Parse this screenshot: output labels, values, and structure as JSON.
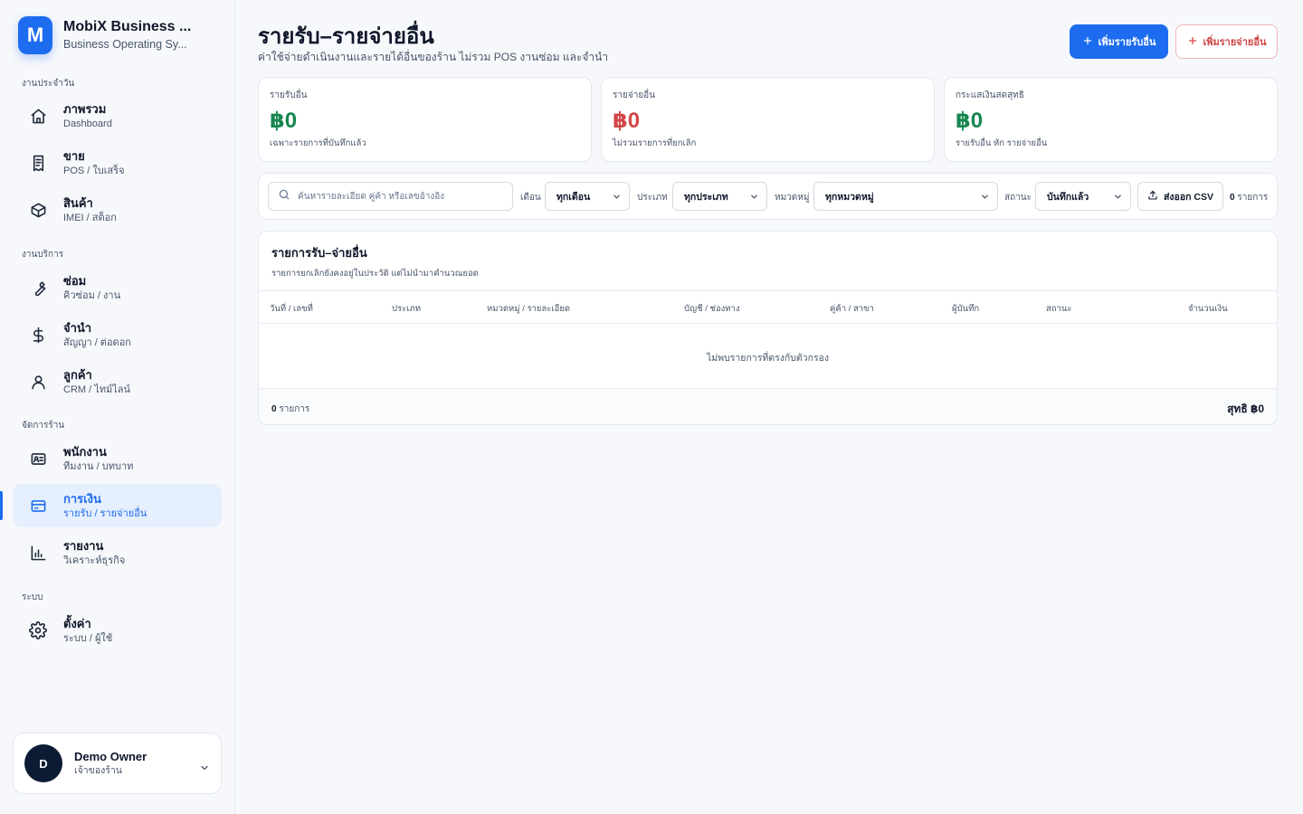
{
  "brand": {
    "logo_letter": "M",
    "title": "MobiX Business ...",
    "subtitle": "Business Operating Sy..."
  },
  "sidebar": {
    "sections": [
      {
        "label": "งานประจำวัน"
      },
      {
        "label": "งานบริการ"
      },
      {
        "label": "จัดการร้าน"
      },
      {
        "label": "ระบบ"
      }
    ],
    "items": [
      {
        "label": "ภาพรวม",
        "sub": "Dashboard",
        "icon": "home-icon"
      },
      {
        "label": "ขาย",
        "sub": "POS / ใบเสร็จ",
        "icon": "receipt-icon"
      },
      {
        "label": "สินค้า",
        "sub": "IMEI / สต็อก",
        "icon": "box-icon"
      },
      {
        "label": "ซ่อม",
        "sub": "คิวซ่อม / งาน",
        "icon": "wrench-icon"
      },
      {
        "label": "จำนำ",
        "sub": "สัญญา / ต่อดอก",
        "icon": "dollar-icon"
      },
      {
        "label": "ลูกค้า",
        "sub": "CRM / ไทม์ไลน์",
        "icon": "user-icon"
      },
      {
        "label": "พนักงาน",
        "sub": "ทีมงาน / บทบาท",
        "icon": "id-card-icon"
      },
      {
        "label": "การเงิน",
        "sub": "รายรับ / รายจ่ายอื่น",
        "icon": "credit-card-icon",
        "active": true
      },
      {
        "label": "รายงาน",
        "sub": "วิเคราะห์ธุรกิจ",
        "icon": "bar-chart-icon"
      },
      {
        "label": "ตั้งค่า",
        "sub": "ระบบ / ผู้ใช้",
        "icon": "gear-icon"
      }
    ]
  },
  "user": {
    "initial": "D",
    "name": "Demo Owner",
    "role": "เจ้าของร้าน"
  },
  "header": {
    "title": "รายรับ–รายจ่ายอื่น",
    "subtitle": "ค่าใช้จ่ายดำเนินงานและรายได้อื่นของร้าน ไม่รวม POS งานซ่อม และจำนำ",
    "add_income_label": "เพิ่มรายรับอื่น",
    "add_expense_label": "เพิ่มรายจ่ายอื่น"
  },
  "stats": [
    {
      "label": "รายรับอื่น",
      "value": "฿0",
      "note": "เฉพาะรายการที่บันทึกแล้ว",
      "color": "#16864f"
    },
    {
      "label": "รายจ่ายอื่น",
      "value": "฿0",
      "note": "ไม่รวมรายการที่ยกเลิก",
      "color": "#d24545"
    },
    {
      "label": "กระแสเงินสดสุทธิ",
      "value": "฿0",
      "note": "รายรับอื่น หัก รายจ่ายอื่น",
      "color": "#16864f"
    }
  ],
  "filters": {
    "search_placeholder": "ค้นหารายละเอียด คู่ค้า หรือเลขอ้างอิง",
    "month_label": "เดือน",
    "month_value": "ทุกเดือน",
    "type_label": "ประเภท",
    "type_value": "ทุกประเภท",
    "category_label": "หมวดหมู่",
    "category_value": "ทุกหมวดหมู่",
    "status_label": "สถานะ",
    "status_value": "บันทึกแล้ว",
    "export_label": "ส่งออก CSV",
    "count_value": "0",
    "count_unit": "รายการ"
  },
  "table": {
    "title": "รายการรับ–จ่ายอื่น",
    "subtitle": "รายการยกเลิกยังคงอยู่ในประวัติ แต่ไม่นำมาคำนวณยอด",
    "columns": [
      "วันที่ / เลขที่",
      "ประเภท",
      "หมวดหมู่ / รายละเอียด",
      "บัญชี / ช่องทาง",
      "คู่ค้า / สาขา",
      "ผู้บันทึก",
      "สถานะ",
      "จำนวนเงิน"
    ],
    "empty_text": "ไม่พบรายการที่ตรงกับตัวกรอง",
    "footer_count": "0",
    "footer_unit": "รายการ",
    "footer_net": "สุทธิ ฿0"
  },
  "colors": {
    "accent": "#1d6cf0",
    "income": "#16864f",
    "expense": "#d24545"
  }
}
